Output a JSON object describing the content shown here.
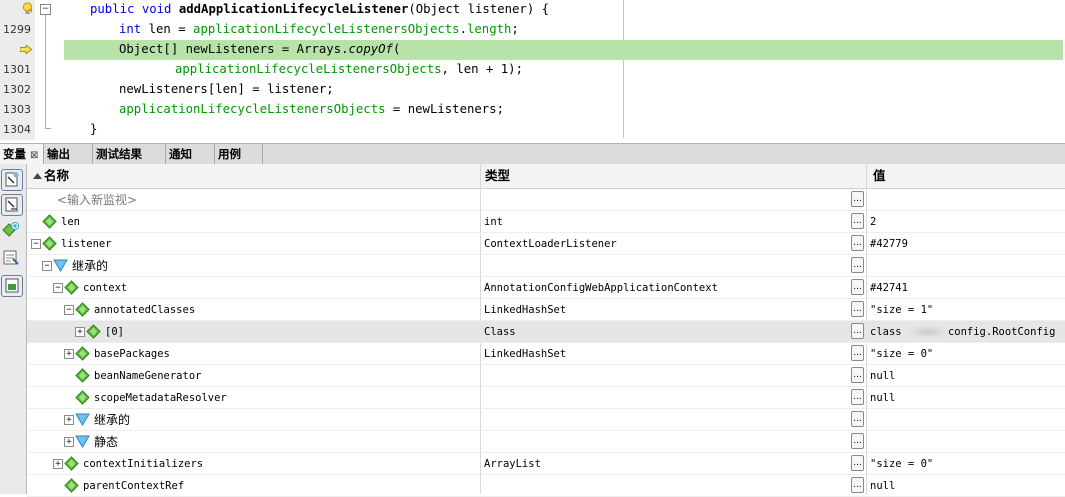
{
  "editor": {
    "lines": [
      {
        "num": "",
        "parts": [
          [
            "kw",
            "public void "
          ],
          [
            "b",
            "addApplicationLifecycleListener"
          ],
          [
            "n",
            "("
          ],
          [
            "n",
            "Object listener"
          ],
          [
            "n",
            ") {"
          ]
        ],
        "indent": 90
      },
      {
        "num": "1299",
        "parts": [
          [
            "kw",
            "int"
          ],
          [
            "n",
            " len = "
          ],
          [
            "fld",
            "applicationLifecycleListenersObjects"
          ],
          [
            "n",
            "."
          ],
          [
            "fld",
            "length"
          ],
          [
            "n",
            ";"
          ]
        ],
        "indent": 119
      },
      {
        "num": "",
        "parts": [
          [
            "n",
            "Object[] newListeners = Arrays."
          ],
          [
            "it",
            "copyOf"
          ],
          [
            "n",
            "("
          ]
        ],
        "indent": 119,
        "highlight": true
      },
      {
        "num": "1301",
        "parts": [
          [
            "fld",
            "applicationLifecycleListenersObjects"
          ],
          [
            "n",
            ", len + 1);"
          ]
        ],
        "indent": 175
      },
      {
        "num": "1302",
        "parts": [
          [
            "n",
            "newListeners[len] = listener;"
          ]
        ],
        "indent": 119
      },
      {
        "num": "1303",
        "parts": [
          [
            "fld",
            "applicationLifecycleListenersObjects"
          ],
          [
            "n",
            " = newListeners;"
          ]
        ],
        "indent": 119
      },
      {
        "num": "1304",
        "parts": [
          [
            "n",
            "}"
          ]
        ],
        "indent": 90
      }
    ]
  },
  "tabs": [
    {
      "label": "变量",
      "close": "⊠",
      "active": true
    },
    {
      "label": "输出"
    },
    {
      "label": "测试结果"
    },
    {
      "label": "通知"
    },
    {
      "label": "用例"
    }
  ],
  "columns": {
    "name": "名称",
    "type": "类型",
    "value": "值",
    "sort_icon": "sort-ascending-icon"
  },
  "rows": [
    {
      "name": "<输入新监视>",
      "type": "",
      "value": "",
      "level": 0,
      "icon": "none",
      "exp": "",
      "placeholder": true
    },
    {
      "name": "len",
      "type": "int",
      "value": "2",
      "level": 0,
      "icon": "field",
      "exp": ""
    },
    {
      "name": "listener",
      "type": "ContextLoaderListener",
      "value": "#42779",
      "level": 0,
      "icon": "field",
      "exp": "−"
    },
    {
      "name": "继承的",
      "type": "",
      "value": "",
      "level": 1,
      "icon": "inherited",
      "exp": "−",
      "cjk": true
    },
    {
      "name": "context",
      "type": "AnnotationConfigWebApplicationContext",
      "value": "#42741",
      "level": 2,
      "icon": "field",
      "exp": "−"
    },
    {
      "name": "annotatedClasses",
      "type": "LinkedHashSet",
      "value": "\"size = 1\"",
      "level": 3,
      "icon": "field",
      "exp": "−"
    },
    {
      "name": "[0]",
      "type": "Class",
      "value_prefix": "class ",
      "value_suffix": "config.RootConfig",
      "level": 4,
      "icon": "field",
      "exp": "+",
      "selected": true
    },
    {
      "name": "basePackages",
      "type": "LinkedHashSet",
      "value": "\"size = 0\"",
      "level": 3,
      "icon": "field",
      "exp": "+"
    },
    {
      "name": "beanNameGenerator",
      "type": "",
      "value": "null",
      "level": 3,
      "icon": "field",
      "exp": ""
    },
    {
      "name": "scopeMetadataResolver",
      "type": "",
      "value": "null",
      "level": 3,
      "icon": "field",
      "exp": ""
    },
    {
      "name": "继承的",
      "type": "",
      "value": "",
      "level": 3,
      "icon": "inherited",
      "exp": "+",
      "cjk": true
    },
    {
      "name": "静态",
      "type": "",
      "value": "",
      "level": 3,
      "icon": "inherited",
      "exp": "+",
      "cjk": true
    },
    {
      "name": "contextInitializers",
      "type": "ArrayList",
      "value": "\"size = 0\"",
      "level": 2,
      "icon": "field",
      "exp": "+"
    },
    {
      "name": "parentContextRef",
      "type": "",
      "value": "null",
      "level": 2,
      "icon": "field",
      "exp": ""
    }
  ],
  "dots_label": "...",
  "colors": {
    "highlight": "#b7e3a8",
    "keyword": "#0000e6",
    "field": "#009900",
    "icon_green": "#4caf2a",
    "icon_blue": "#3aa0e0"
  },
  "toolbar_icons": [
    "new-watch-icon",
    "watch-icon",
    "add-watch-icon",
    "evaluate-icon",
    "show-classes-icon"
  ]
}
